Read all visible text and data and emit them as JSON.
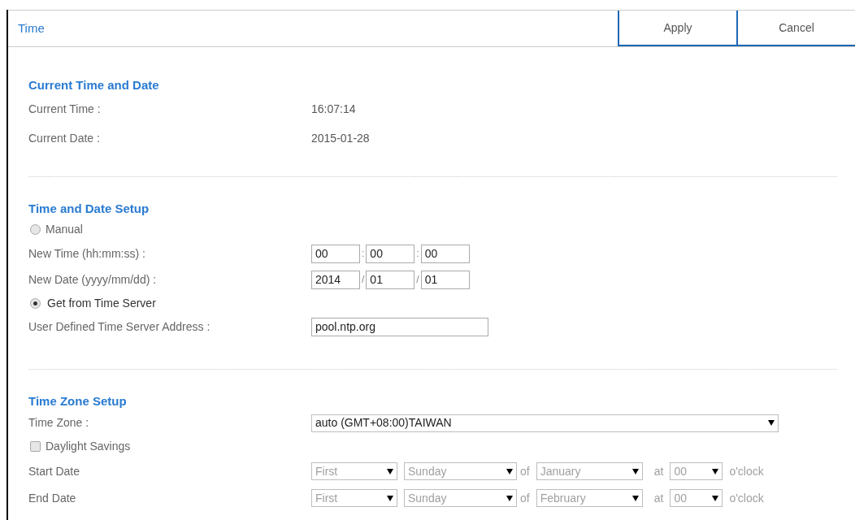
{
  "header": {
    "title": "Time",
    "buttons": [
      "Apply",
      "Cancel"
    ]
  },
  "current": {
    "heading": "Current Time and Date",
    "rows": [
      {
        "label": "Current Time :",
        "value": "16:07:14"
      },
      {
        "label": "Current Date :",
        "value": "2015-01-28"
      }
    ]
  },
  "setup": {
    "heading": "Time and Date Setup",
    "manual": {
      "label": "Manual",
      "selected": false
    },
    "new_time": {
      "label": "New Time (hh:mm:ss) :",
      "fields": [
        "00",
        "00",
        "00"
      ],
      "separator": ":"
    },
    "new_date": {
      "label": "New Date (yyyy/mm/dd) :",
      "fields": [
        "2014",
        "01",
        "01"
      ],
      "separator": "/"
    },
    "server": {
      "label": "Get from Time Server",
      "selected": true
    },
    "server_address": {
      "label": "User Defined Time Server Address :",
      "value": "pool.ntp.org"
    }
  },
  "zone": {
    "heading": "Time Zone Setup",
    "time_zone": {
      "label": "Time Zone :",
      "value": "auto (GMT+08:00)TAIWAN"
    },
    "daylight": {
      "label": "Daylight Savings",
      "checked": false
    },
    "rows": [
      {
        "label": "Start Date",
        "week": "First",
        "day": "Sunday",
        "of": "of",
        "month": "January",
        "at": "at",
        "hour": "00",
        "suffix": "o'clock",
        "disabled": true
      },
      {
        "label": "End Date",
        "week": "First",
        "day": "Sunday",
        "of": "of",
        "month": "February",
        "at": "at",
        "hour": "00",
        "suffix": "o'clock",
        "disabled": true
      }
    ]
  }
}
